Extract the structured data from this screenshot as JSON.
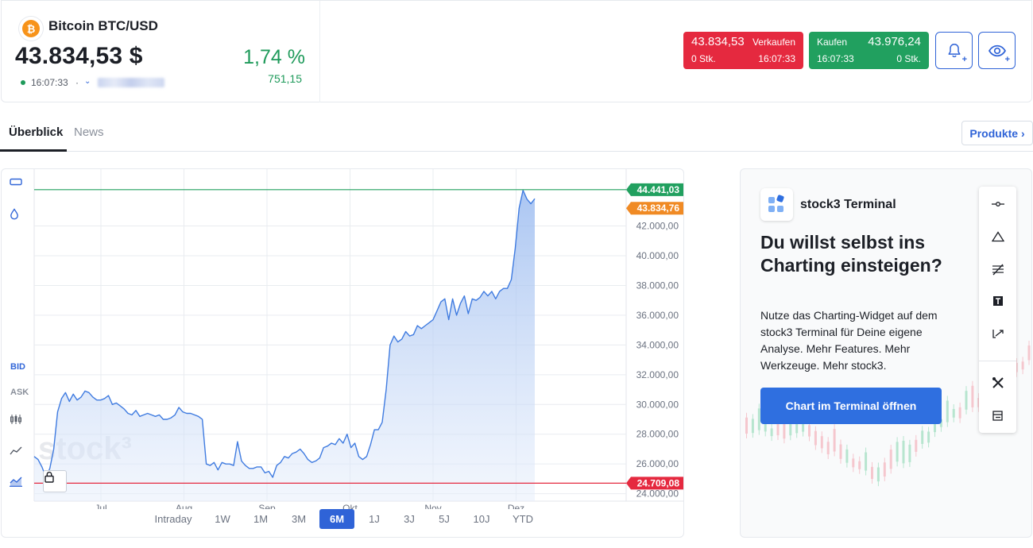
{
  "header": {
    "coin_symbol": "₿",
    "instrument_name": "Bitcoin BTC/USD",
    "price": "43.834,53 $",
    "change_percent": "1,74 %",
    "change_absolute": "751,15",
    "time": "16:07:33",
    "separator": "·",
    "exchange_chevron": "⌄"
  },
  "sell": {
    "price": "43.834,53",
    "label": "Verkaufen",
    "qty": "0 Stk.",
    "time": "16:07:33",
    "color": "#e5293f"
  },
  "buy": {
    "label": "Kaufen",
    "price": "43.976,24",
    "time": "16:07:33",
    "qty": "0 Stk.",
    "color": "#21a05f"
  },
  "actions": {
    "alert_icon": "bell-plus-icon",
    "watch_icon": "eye-plus-icon",
    "plus": "+"
  },
  "tabs": [
    {
      "label": "Überblick",
      "active": true
    },
    {
      "label": "News",
      "active": false
    }
  ],
  "produkte_label": "Produkte ›",
  "chart_sidebar": {
    "bid_label": "BID",
    "ask_label": "ASK"
  },
  "chart_data": {
    "type": "area",
    "watermark": "stock³",
    "x_tick_labels": [
      "Jul",
      "Aug",
      "Sep",
      "Okt",
      "Nov",
      "Dez"
    ],
    "y_tick_labels": [
      "24.000,00",
      "26.000,00",
      "28.000,00",
      "30.000,00",
      "32.000,00",
      "34.000,00",
      "36.000,00",
      "38.000,00",
      "40.000,00",
      "42.000,00"
    ],
    "ylim": [
      23500,
      45500
    ],
    "y": [
      26500,
      26300,
      25800,
      25100,
      25700,
      27000,
      29500,
      30400,
      30800,
      30200,
      30700,
      30300,
      30500,
      30900,
      30800,
      30500,
      30300,
      30300,
      30400,
      30600,
      30000,
      30100,
      29900,
      29700,
      29400,
      29300,
      29600,
      29200,
      29300,
      29400,
      29300,
      29200,
      29300,
      29000,
      29000,
      29100,
      29300,
      29800,
      29500,
      29400,
      29400,
      29300,
      29200,
      29000,
      26000,
      25900,
      26100,
      25600,
      26100,
      26000,
      26000,
      25900,
      27500,
      26200,
      25900,
      25700,
      25700,
      25800,
      25800,
      25400,
      25500,
      25100,
      25900,
      26100,
      26500,
      26400,
      26700,
      26800,
      27000,
      26700,
      26300,
      26100,
      26200,
      26400,
      27100,
      27200,
      27400,
      27300,
      27700,
      27400,
      28000,
      27100,
      27400,
      26500,
      26300,
      26500,
      27300,
      28300,
      28300,
      28800,
      31000,
      34000,
      34600,
      34200,
      34400,
      34900,
      34600,
      34700,
      35300,
      35100,
      35300,
      35500,
      35700,
      36300,
      36900,
      37100,
      35700,
      37100,
      36000,
      36800,
      37300,
      36100,
      37100,
      37000,
      37200,
      37600,
      37300,
      37600,
      37100,
      37600,
      37800,
      37800,
      38400,
      40500,
      43200,
      44400,
      43800,
      43500,
      43834.53
    ],
    "last_value": 43834.53,
    "period_high": 44441.03,
    "period_low": 24709.08,
    "last_label": "43.834,76",
    "high_label": "44.441,03",
    "low_label": "24.709,08",
    "high_color": "#21a05f",
    "low_color": "#e5293f",
    "line_color": "#3f7be0",
    "grid": true
  },
  "ranges": [
    {
      "label": "Intraday",
      "active": false
    },
    {
      "label": "1W",
      "active": false
    },
    {
      "label": "1M",
      "active": false
    },
    {
      "label": "3M",
      "active": false
    },
    {
      "label": "6M",
      "active": true
    },
    {
      "label": "1J",
      "active": false
    },
    {
      "label": "3J",
      "active": false
    },
    {
      "label": "5J",
      "active": false
    },
    {
      "label": "10J",
      "active": false
    },
    {
      "label": "YTD",
      "active": false
    }
  ],
  "promo": {
    "brand": "stock3 Terminal",
    "title": "Du willst selbst ins Charting einsteigen?",
    "text": "Nutze das Charting-Widget auf dem stock3 Terminal für Deine eigene Analyse. Mehr Features. Mehr Werkzeuge. Mehr stock3.",
    "cta_label": "Chart im Terminal öffnen",
    "toolbar_icons": [
      "line-tool-icon",
      "triangle-tool-icon",
      "fib-tool-icon",
      "text-tool-icon",
      "arrow-tool-icon",
      "tools-icon",
      "layout-icon"
    ]
  }
}
